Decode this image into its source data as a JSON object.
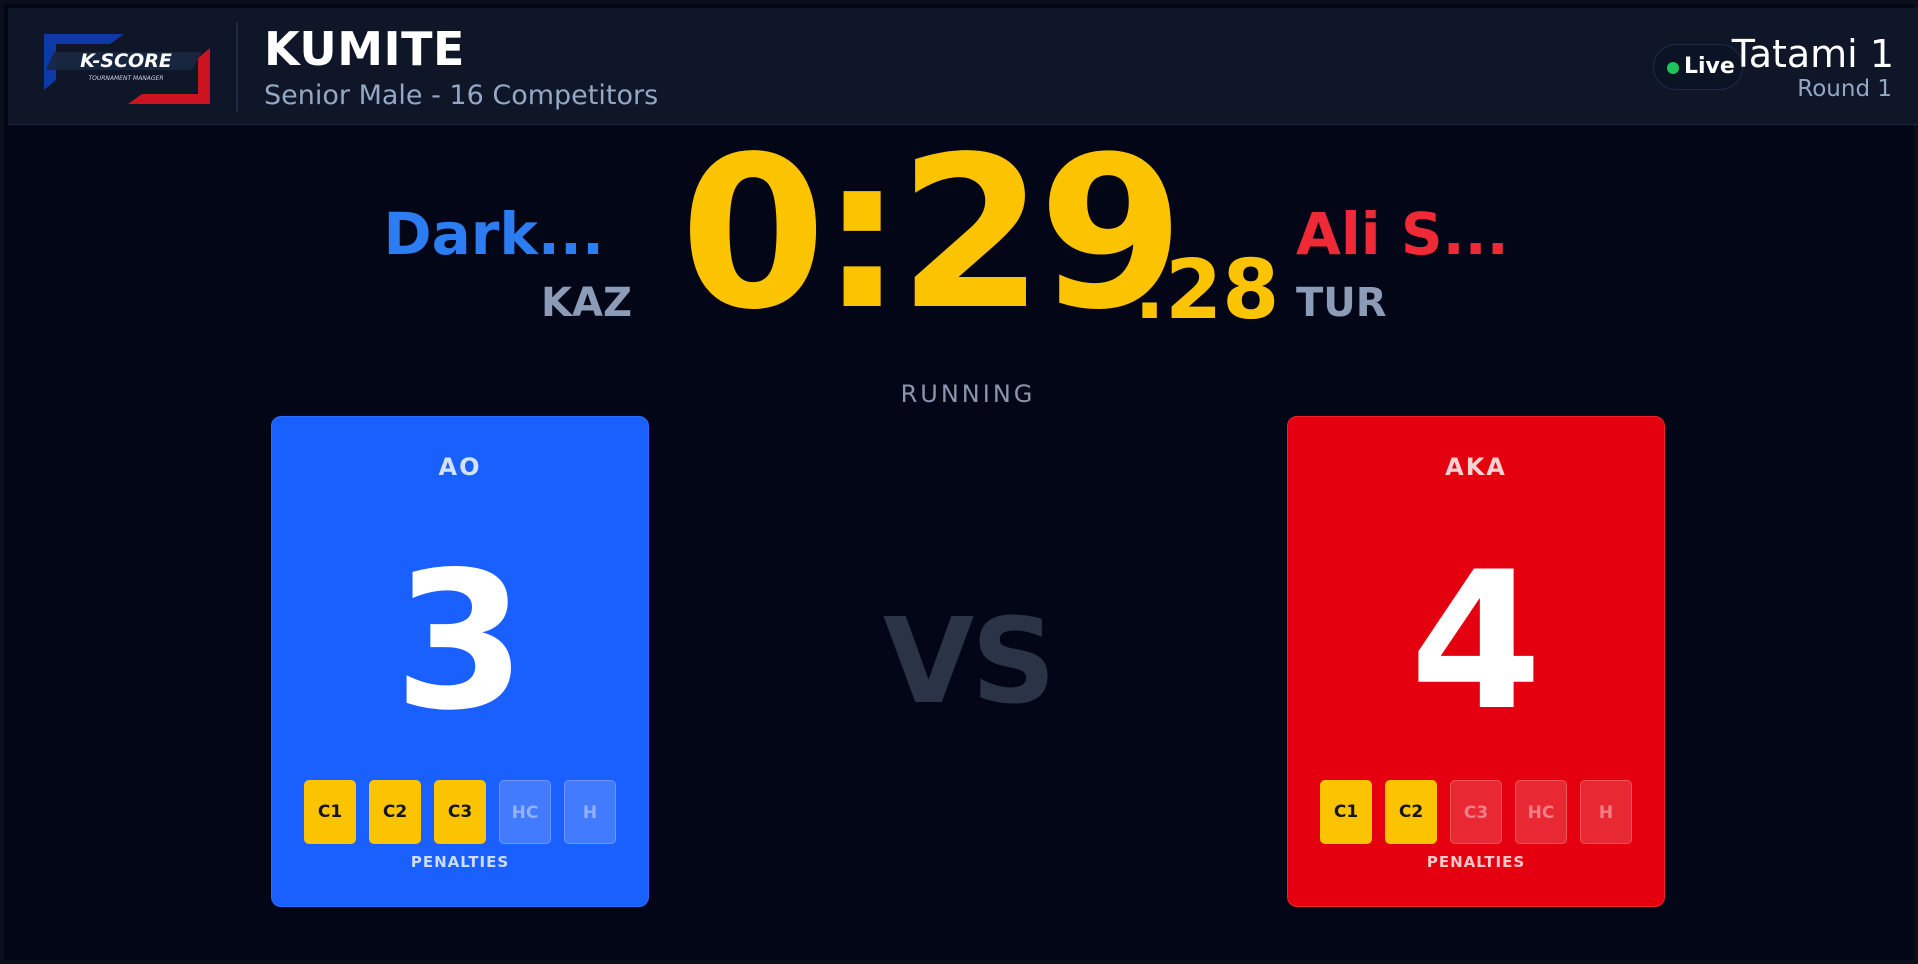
{
  "header": {
    "logo_text": "K-SCORE",
    "logo_subtext": "TOURNAMENT MANAGER",
    "title": "KUMITE",
    "subtitle": "Senior Male - 16 Competitors",
    "live_label": "Live",
    "tatami": "Tatami 1",
    "round": "Round 1"
  },
  "timer": {
    "main": "0:29",
    "fraction": ".28",
    "status": "RUNNING"
  },
  "competitors": {
    "ao": {
      "name": "Dark...",
      "country": "KAZ",
      "side_label": "AO",
      "score": "3"
    },
    "aka": {
      "name": "Ali S...",
      "country": "TUR",
      "side_label": "AKA",
      "score": "4"
    }
  },
  "vs_label": "VS",
  "penalties_label": "PENALTIES",
  "penalties": {
    "ao": [
      {
        "label": "C1",
        "active": true
      },
      {
        "label": "C2",
        "active": true
      },
      {
        "label": "C3",
        "active": true
      },
      {
        "label": "HC",
        "active": false
      },
      {
        "label": "H",
        "active": false
      }
    ],
    "aka": [
      {
        "label": "C1",
        "active": true
      },
      {
        "label": "C2",
        "active": true
      },
      {
        "label": "C3",
        "active": false
      },
      {
        "label": "HC",
        "active": false
      },
      {
        "label": "H",
        "active": false
      }
    ]
  },
  "colors": {
    "background": "#030617",
    "header_bg": "#0e1628",
    "ao": "#1a5fff",
    "aka": "#e4000e",
    "timer": "#fcc400",
    "penalty_active": "#fcc400",
    "live_dot": "#1ec45b"
  }
}
